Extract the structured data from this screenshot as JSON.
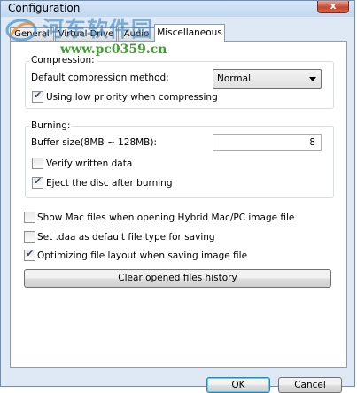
{
  "window": {
    "title": "Configuration",
    "close_label": "x"
  },
  "watermark": {
    "chinese": "河东软件园",
    "url": "www.pc0359.cn"
  },
  "tabs": [
    {
      "label": "General"
    },
    {
      "label": "Virtual Drive"
    },
    {
      "label": "Audio"
    },
    {
      "label": "Miscellaneous"
    }
  ],
  "compression": {
    "group_label": "Compression:",
    "method_label": "Default compression method:",
    "method_value": "Normal",
    "low_priority_label": "Using low priority when compressing",
    "low_priority_checked": true
  },
  "burning": {
    "group_label": "Burning:",
    "buffer_label": "Buffer size(8MB ~ 128MB):",
    "buffer_value": "8",
    "verify_label": "Verify written data",
    "verify_checked": false,
    "eject_label": "Eject the disc after burning",
    "eject_checked": true
  },
  "options": {
    "show_mac_label": "Show Mac files when opening Hybrid Mac/PC image file",
    "show_mac_checked": false,
    "daa_default_label": "Set .daa as default file type for saving",
    "daa_default_checked": false,
    "optimize_label": "Optimizing file layout when saving image file",
    "optimize_checked": true,
    "clear_history_label": "Clear opened files history"
  },
  "footer": {
    "ok_label": "OK",
    "cancel_label": "Cancel"
  }
}
